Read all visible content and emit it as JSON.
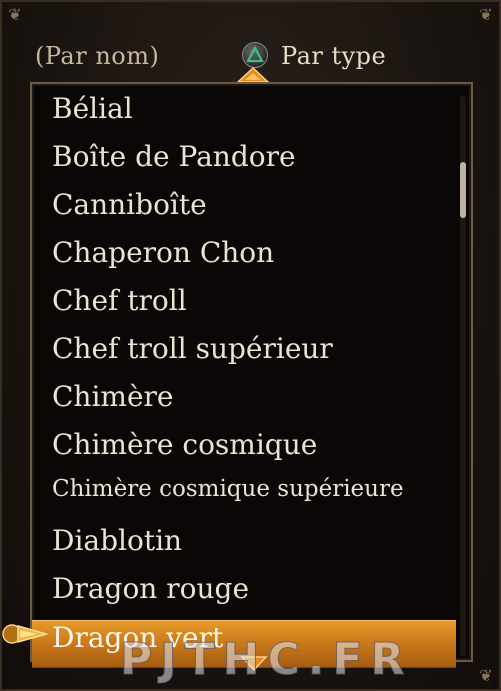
{
  "header": {
    "sort_by_name": "(Par nom)",
    "sort_by_type": "Par type",
    "button_icon": "triangle-button-icon"
  },
  "list": {
    "items": [
      {
        "label": "Bélial"
      },
      {
        "label": "Boîte de Pandore"
      },
      {
        "label": "Canniboîte"
      },
      {
        "label": "Chaperon Chon"
      },
      {
        "label": "Chef troll"
      },
      {
        "label": "Chef troll supérieur"
      },
      {
        "label": "Chimère"
      },
      {
        "label": "Chimère cosmique"
      },
      {
        "label": "Chimère cosmique supérieure"
      },
      {
        "label": "Diablotin"
      },
      {
        "label": "Dragon rouge"
      },
      {
        "label": "Dragon vert"
      }
    ],
    "selected_index": 11,
    "scroll_position": 0.12
  },
  "watermark": "PJTHC.FR",
  "colors": {
    "selection": "#c9781a",
    "text": "#ece3d2",
    "border": "#6b5a44",
    "triangle": "#3fbf8a"
  }
}
